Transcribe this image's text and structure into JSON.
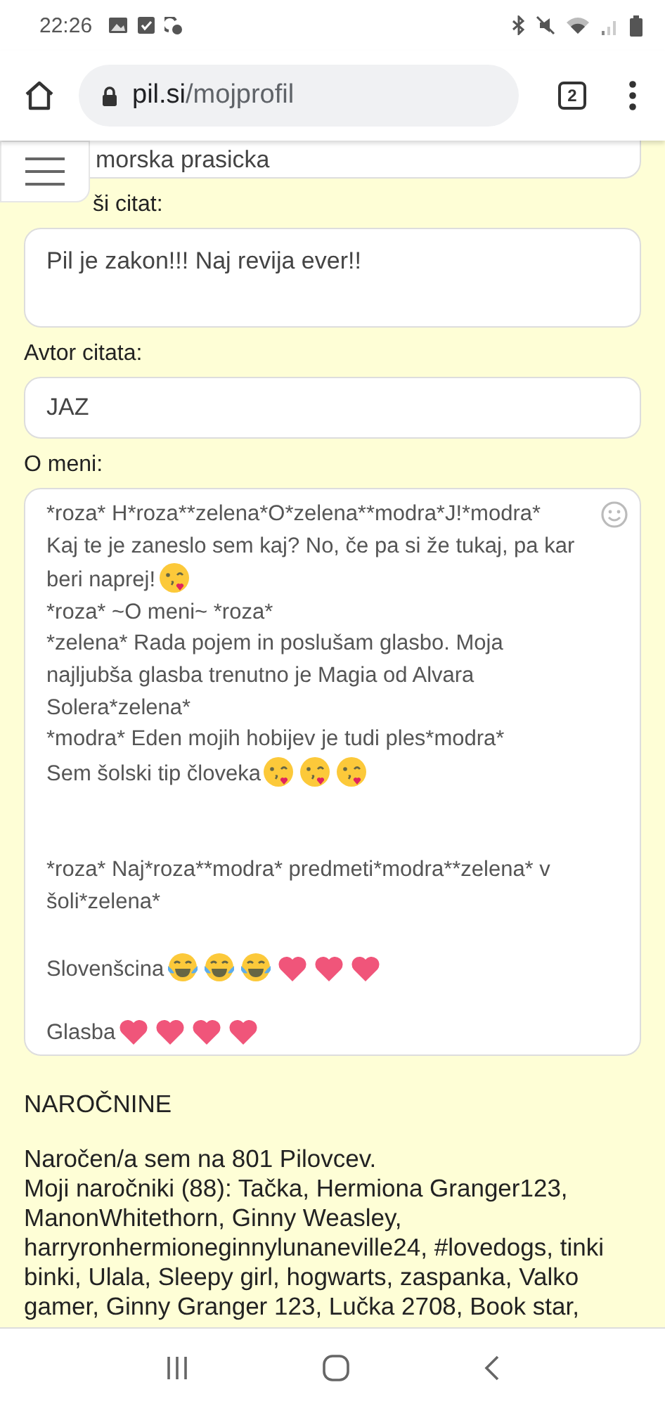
{
  "status_bar": {
    "time": "22:26"
  },
  "browser": {
    "host": "pil.si",
    "path": "/mojprofil",
    "tab_count": "2"
  },
  "top_field": {
    "value": "morska prasicka"
  },
  "quote": {
    "label": "ši citat:",
    "value": "Pil je zakon!!! Naj revija ever!!"
  },
  "author": {
    "label": "Avtor citata:",
    "value": "JAZ"
  },
  "about": {
    "label": "O meni:",
    "lines": [
      {
        "kind": "paragraph",
        "parts": [
          {
            "kind": "text",
            "text": "*roza* H*roza**zelena*O*zelena**modra*J!*modra*"
          }
        ]
      },
      {
        "kind": "paragraph",
        "parts": [
          {
            "kind": "text",
            "text": "Kaj te je zaneslo sem kaj? No, če pa si že tukaj, pa kar"
          }
        ]
      },
      {
        "kind": "paragraph",
        "parts": [
          {
            "kind": "text",
            "text": "beri naprej!"
          },
          {
            "kind": "kiss"
          }
        ]
      },
      {
        "kind": "paragraph",
        "parts": [
          {
            "kind": "text",
            "text": "*roza* ~O meni~ *roza*"
          }
        ]
      },
      {
        "kind": "paragraph",
        "parts": [
          {
            "kind": "text",
            "text": "*zelena* Rada pojem in poslušam glasbo. Moja najljubša glasba trenutno je Magia od Alvara Solera*zelena*"
          }
        ]
      },
      {
        "kind": "paragraph",
        "parts": [
          {
            "kind": "text",
            "text": "*modra* Eden mojih hobijev je tudi ples*modra*"
          }
        ]
      },
      {
        "kind": "paragraph",
        "parts": [
          {
            "kind": "text",
            "text": "Sem šolski tip človeka"
          },
          {
            "kind": "kiss"
          },
          {
            "kind": "kiss"
          },
          {
            "kind": "kiss"
          }
        ]
      },
      {
        "kind": "blank"
      },
      {
        "kind": "blank"
      },
      {
        "kind": "paragraph",
        "parts": [
          {
            "kind": "text",
            "text": "*roza* Naj*roza**modra* predmeti*modra**zelena* v šoli*zelena*"
          }
        ]
      },
      {
        "kind": "blank"
      },
      {
        "kind": "paragraph",
        "parts": [
          {
            "kind": "text",
            "text": "Slovenšcina"
          },
          {
            "kind": "laugh"
          },
          {
            "kind": "laugh"
          },
          {
            "kind": "laugh"
          },
          {
            "kind": "heart"
          },
          {
            "kind": "heart"
          },
          {
            "kind": "heart"
          }
        ]
      },
      {
        "kind": "blank"
      },
      {
        "kind": "paragraph",
        "parts": [
          {
            "kind": "text",
            "text": "Glasba"
          },
          {
            "kind": "heart"
          },
          {
            "kind": "heart"
          },
          {
            "kind": "heart"
          },
          {
            "kind": "heart"
          }
        ]
      }
    ]
  },
  "subscriptions": {
    "heading": "NAROČNINE",
    "lines": [
      "Naročen/a sem na 801 Pilovcev.",
      "Moji naročniki (88): Tačka, Hermiona Granger123, ManonWhitethorn, Ginny Weasley, harryronhermioneginnylunaneville24, #lovedogs, tinki binki, Ulala, Sleepy girl, hogwarts, zaspanka, Valko gamer, Ginny Granger 123, Lučka 2708, Book star,"
    ]
  }
}
